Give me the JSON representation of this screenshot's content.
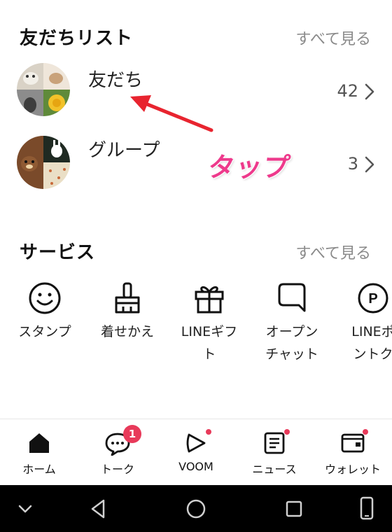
{
  "friend_list": {
    "title": "友だちリスト",
    "see_all": "すべて見る",
    "rows": [
      {
        "label": "友だち",
        "count": "42"
      },
      {
        "label": "グループ",
        "count": "3"
      }
    ]
  },
  "annotation": {
    "text": "タップ",
    "color": "#ee3a8c"
  },
  "services": {
    "title": "サービス",
    "see_all": "すべて見る",
    "items": [
      {
        "label": "スタンプ",
        "icon": "smiley-icon"
      },
      {
        "label": "着せかえ",
        "icon": "brush-icon"
      },
      {
        "label": "LINEギフ\nト",
        "icon": "gift-icon"
      },
      {
        "label": "オープン\nチャット",
        "icon": "chat-bubble-icon"
      },
      {
        "label": "LINEポ\nントク",
        "icon": "points-icon"
      }
    ]
  },
  "bottom_nav": {
    "items": [
      {
        "label": "ホーム",
        "icon": "home-icon"
      },
      {
        "label": "トーク",
        "icon": "talk-icon",
        "badge": "1"
      },
      {
        "label": "VOOM",
        "icon": "voom-icon"
      },
      {
        "label": "ニュース",
        "icon": "news-icon"
      },
      {
        "label": "ウォレット",
        "icon": "wallet-icon"
      }
    ]
  },
  "colors": {
    "accent": "#e83a5a",
    "muted_text": "#8a8a8a",
    "system_bar": "#000000"
  }
}
